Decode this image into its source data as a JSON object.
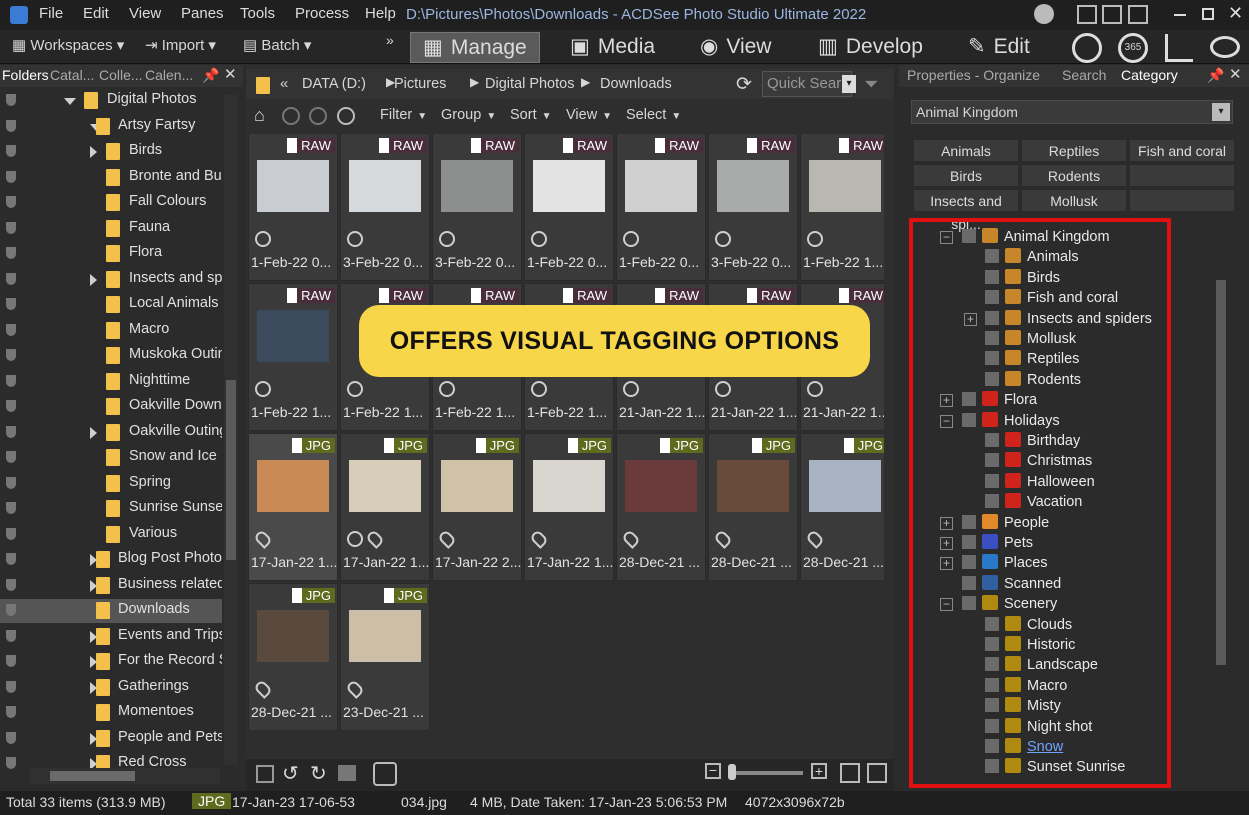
{
  "window": {
    "title": "D:\\Pictures\\Photos\\Downloads - ACDSee Photo Studio Ultimate 2022"
  },
  "menu": [
    "File",
    "Edit",
    "View",
    "Panes",
    "Tools",
    "Process",
    "Help"
  ],
  "toolbar": {
    "workspaces": "Workspaces",
    "import": "Import",
    "batch": "Batch"
  },
  "modes": [
    "Manage",
    "Media",
    "View",
    "Develop",
    "Edit"
  ],
  "left": {
    "tabs": [
      "Folders",
      "Catal...",
      "Colle...",
      "Calen..."
    ],
    "tree": [
      {
        "label": "Digital Photos",
        "indent": 1,
        "exp": "down"
      },
      {
        "label": "Artsy Fartsy",
        "indent": 2,
        "exp": "down"
      },
      {
        "label": "Birds",
        "indent": 3,
        "exp": "right"
      },
      {
        "label": "Bronte and Bur",
        "indent": 3
      },
      {
        "label": "Fall Colours",
        "indent": 3
      },
      {
        "label": "Fauna",
        "indent": 3
      },
      {
        "label": "Flora",
        "indent": 3
      },
      {
        "label": "Insects and spi",
        "indent": 3,
        "exp": "right"
      },
      {
        "label": "Local Animals",
        "indent": 3
      },
      {
        "label": "Macro",
        "indent": 3
      },
      {
        "label": "Muskoka Outin",
        "indent": 3
      },
      {
        "label": "Nighttime",
        "indent": 3
      },
      {
        "label": "Oakville Downto",
        "indent": 3
      },
      {
        "label": "Oakville Outing:",
        "indent": 3,
        "exp": "right"
      },
      {
        "label": "Snow and Ice",
        "indent": 3
      },
      {
        "label": "Spring",
        "indent": 3
      },
      {
        "label": "Sunrise Sunset",
        "indent": 3
      },
      {
        "label": "Various",
        "indent": 3
      },
      {
        "label": "Blog Post Photos",
        "indent": 2,
        "exp": "right"
      },
      {
        "label": "Business related",
        "indent": 2,
        "exp": "right"
      },
      {
        "label": "Downloads",
        "indent": 2,
        "selected": true
      },
      {
        "label": "Events and Trips",
        "indent": 2,
        "exp": "right"
      },
      {
        "label": "For the Record S",
        "indent": 2,
        "exp": "right"
      },
      {
        "label": "Gatherings",
        "indent": 2,
        "exp": "right"
      },
      {
        "label": "Momentoes",
        "indent": 2
      },
      {
        "label": "People and Pets",
        "indent": 2,
        "exp": "right"
      },
      {
        "label": "Red Cross",
        "indent": 2,
        "exp": "right"
      }
    ]
  },
  "center": {
    "breadcrumb": [
      "DATA (D:)",
      "Pictures",
      "Digital Photos",
      "Downloads"
    ],
    "quicksearch_placeholder": "Quick Sear",
    "filterbar": [
      "Filter",
      "Group",
      "Sort",
      "View",
      "Select"
    ],
    "thumbs": [
      {
        "badge": "RAW",
        "cap": "1-Feb-22 0...",
        "color": "#c9cdd2"
      },
      {
        "badge": "RAW",
        "cap": "3-Feb-22 0...",
        "color": "#d6d9dc"
      },
      {
        "badge": "RAW",
        "cap": "3-Feb-22 0...",
        "color": "#8d8f8f"
      },
      {
        "badge": "RAW",
        "cap": "1-Feb-22 0...",
        "color": "#e3e3e3"
      },
      {
        "badge": "RAW",
        "cap": "1-Feb-22 0...",
        "color": "#d0d0d0"
      },
      {
        "badge": "RAW",
        "cap": "3-Feb-22 0...",
        "color": "#a9aaaa"
      },
      {
        "badge": "RAW",
        "cap": "1-Feb-22 1...",
        "color": "#b8b8b0"
      },
      {
        "badge": "RAW",
        "cap": "1-Feb-22 1...",
        "color": "#3b4a5c"
      },
      {
        "badge": "RAW",
        "cap": "1-Feb-22 1...",
        "color": "#555"
      },
      {
        "badge": "RAW",
        "cap": "1-Feb-22 1...",
        "color": "#555"
      },
      {
        "badge": "RAW",
        "cap": "1-Feb-22 1...",
        "color": "#555"
      },
      {
        "badge": "RAW",
        "cap": "21-Jan-22 1...",
        "color": "#555"
      },
      {
        "badge": "RAW",
        "cap": "21-Jan-22 1...",
        "color": "#555"
      },
      {
        "badge": "RAW",
        "cap": "21-Jan-22 1...",
        "color": "#555"
      },
      {
        "badge": "JPG",
        "cap": "17-Jan-22 1...",
        "color": "#c98a55"
      },
      {
        "badge": "JPG",
        "cap": "17-Jan-22 1...",
        "color": "#d8cdb8"
      },
      {
        "badge": "JPG",
        "cap": "17-Jan-22 2...",
        "color": "#cfc2a9"
      },
      {
        "badge": "JPG",
        "cap": "17-Jan-22 1...",
        "color": "#d9d6cf"
      },
      {
        "badge": "JPG",
        "cap": "28-Dec-21 ...",
        "color": "#6b3b3b"
      },
      {
        "badge": "JPG",
        "cap": "28-Dec-21 ...",
        "color": "#6a4a3a"
      },
      {
        "badge": "JPG",
        "cap": "28-Dec-21 ...",
        "color": "#a9b3c3"
      },
      {
        "badge": "JPG",
        "cap": "28-Dec-21 ...",
        "color": "#5a4a3e"
      },
      {
        "badge": "JPG",
        "cap": "23-Dec-21 ...",
        "color": "#cdbfa7"
      }
    ],
    "banner": "OFFERS VISUAL TAGGING OPTIONS"
  },
  "right": {
    "tabs": [
      "Properties - Organize",
      "Search",
      "Category"
    ],
    "dropdown": "Animal Kingdom",
    "buttons": [
      "Animals",
      "Reptiles",
      "Fish and coral",
      "Birds",
      "Rodents",
      "",
      "Insects and spi...",
      "Mollusk",
      ""
    ],
    "tree": [
      {
        "label": "Animal Kingdom",
        "lvl": 0,
        "pm": "−",
        "icon": "#c8862a"
      },
      {
        "label": "Animals",
        "lvl": 1,
        "icon": "#c8862a"
      },
      {
        "label": "Birds",
        "lvl": 1,
        "icon": "#c8862a"
      },
      {
        "label": "Fish and coral",
        "lvl": 1,
        "icon": "#c8862a"
      },
      {
        "label": "Insects and spiders",
        "lvl": 1,
        "pm": "+",
        "icon": "#c8862a"
      },
      {
        "label": "Mollusk",
        "lvl": 1,
        "icon": "#c8862a"
      },
      {
        "label": "Reptiles",
        "lvl": 1,
        "icon": "#c8862a"
      },
      {
        "label": "Rodents",
        "lvl": 1,
        "icon": "#c8862a"
      },
      {
        "label": "Flora",
        "lvl": 0,
        "pm": "+",
        "icon": "#d0231c"
      },
      {
        "label": "Holidays",
        "lvl": 0,
        "pm": "−",
        "icon": "#d0231c"
      },
      {
        "label": "Birthday",
        "lvl": 1,
        "icon": "#d0231c"
      },
      {
        "label": "Christmas",
        "lvl": 1,
        "icon": "#d0231c"
      },
      {
        "label": "Halloween",
        "lvl": 1,
        "icon": "#d0231c"
      },
      {
        "label": "Vacation",
        "lvl": 1,
        "icon": "#d0231c"
      },
      {
        "label": "People",
        "lvl": 0,
        "pm": "+",
        "icon": "#e08a2a"
      },
      {
        "label": "Pets",
        "lvl": 0,
        "pm": "+",
        "icon": "#3b4fc2"
      },
      {
        "label": "Places",
        "lvl": 0,
        "pm": "+",
        "icon": "#2a78c8"
      },
      {
        "label": "Scanned",
        "lvl": 0,
        "icon": "#3060a0"
      },
      {
        "label": "Scenery",
        "lvl": 0,
        "pm": "−",
        "icon": "#b08a10"
      },
      {
        "label": "Clouds",
        "lvl": 1,
        "icon": "#b08a10"
      },
      {
        "label": "Historic",
        "lvl": 1,
        "icon": "#b08a10"
      },
      {
        "label": "Landscape",
        "lvl": 1,
        "icon": "#b08a10"
      },
      {
        "label": "Macro",
        "lvl": 1,
        "icon": "#b08a10"
      },
      {
        "label": "Misty",
        "lvl": 1,
        "icon": "#b08a10"
      },
      {
        "label": "Night shot",
        "lvl": 1,
        "icon": "#b08a10"
      },
      {
        "label": "Snow",
        "lvl": 1,
        "icon": "#b08a10",
        "link": true
      },
      {
        "label": "Sunset Sunrise",
        "lvl": 1,
        "icon": "#b08a10"
      }
    ]
  },
  "status": {
    "total": "Total 33 items  (313.9 MB)",
    "type": "JPG",
    "date": "17-Jan-23 17-06-53",
    "file": "034.jpg",
    "info": "4 MB, Date Taken: 17-Jan-23 5:06:53 PM",
    "dims": "4072x3096x72b"
  }
}
